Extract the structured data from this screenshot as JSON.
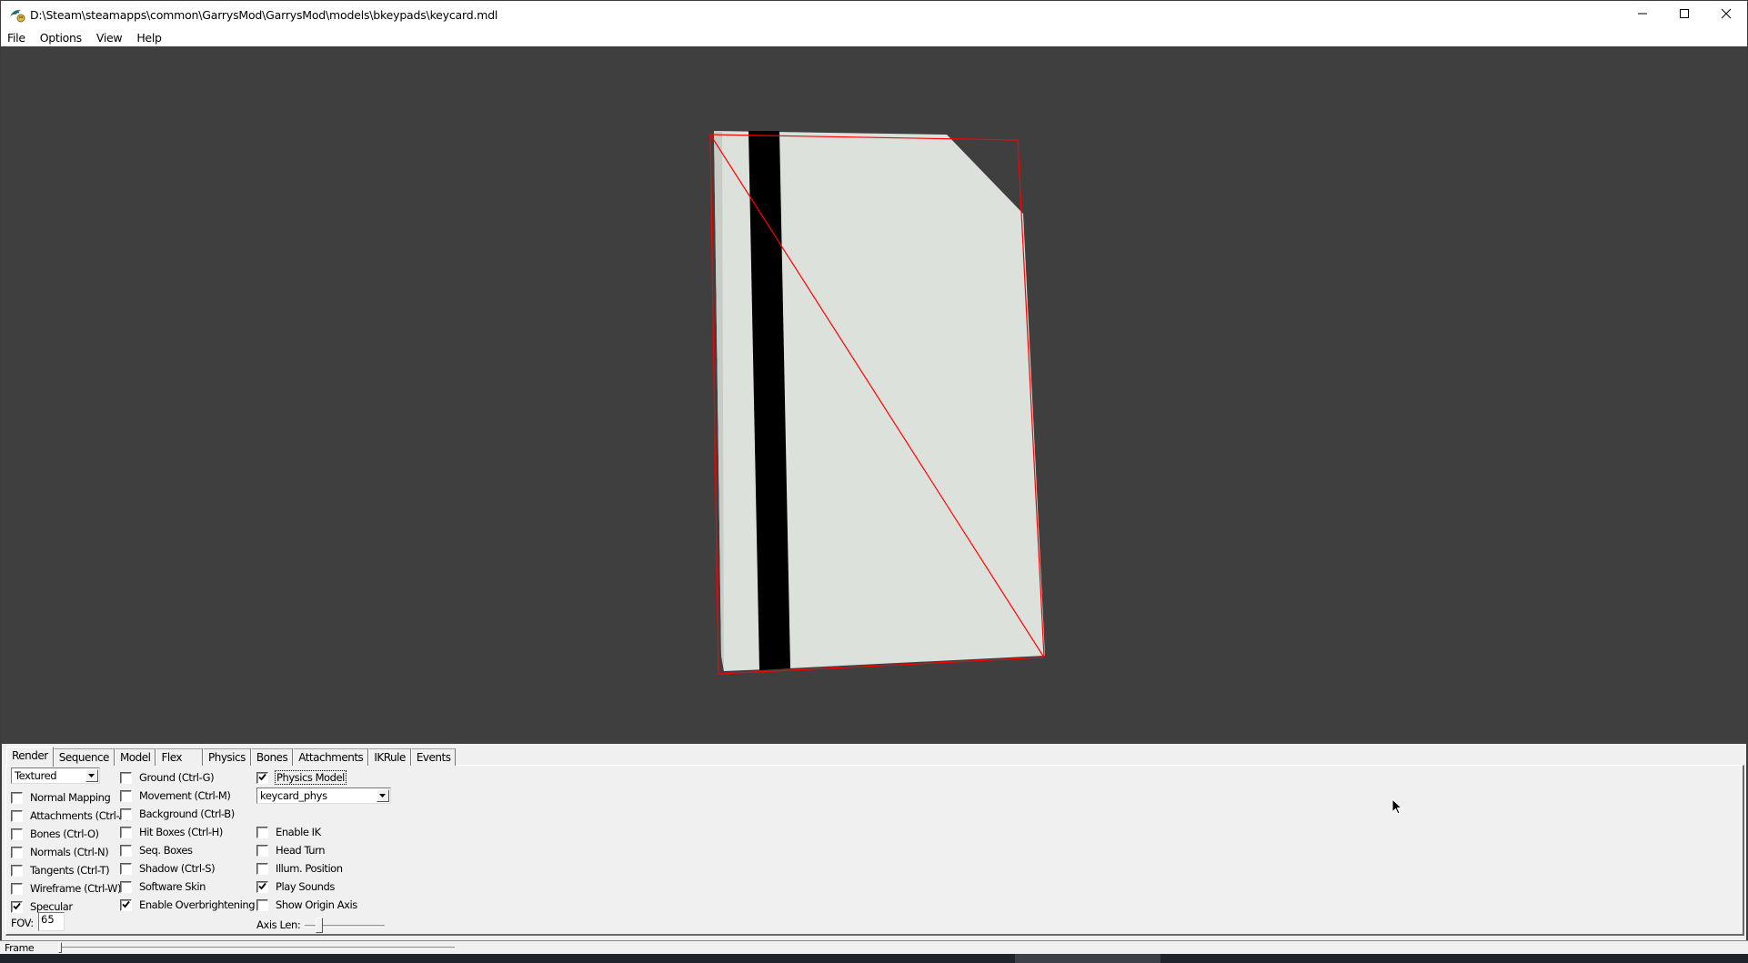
{
  "window": {
    "title": "D:\\Steam\\steamapps\\common\\GarrysMod\\GarrysMod\\models\\bkeypads\\keycard.mdl",
    "app_icon": "hlmv-icon",
    "controls": {
      "minimize": "minimize-icon",
      "maximize": "maximize-icon",
      "close": "close-icon"
    }
  },
  "menubar": {
    "items": [
      "File",
      "Options",
      "View",
      "Help"
    ]
  },
  "viewport": {
    "background": "#3f3f3f",
    "model_color": "#dde1dc",
    "stripe_color": "#000000",
    "physics_wire_color": "#ff0000"
  },
  "tabs": {
    "active": "Render",
    "items": [
      "Render",
      "Sequence",
      "Model",
      "Flex",
      "Physics",
      "Bones",
      "Attachments",
      "IKRule",
      "Events"
    ]
  },
  "render": {
    "render_mode": "Textured",
    "physics_model_combo": "keycard_phys",
    "column1": [
      {
        "label": "Normal Mapping",
        "checked": false
      },
      {
        "label": "Attachments (Ctrl-A)",
        "checked": false
      },
      {
        "label": "Bones (Ctrl-O)",
        "checked": false
      },
      {
        "label": "Normals (Ctrl-N)",
        "checked": false
      },
      {
        "label": "Tangents (Ctrl-T)",
        "checked": false
      },
      {
        "label": "Wireframe (Ctrl-W)",
        "checked": false
      },
      {
        "label": "Specular",
        "checked": true
      }
    ],
    "column2": [
      {
        "label": "Ground (Ctrl-G)",
        "checked": false
      },
      {
        "label": "Movement (Ctrl-M)",
        "checked": false
      },
      {
        "label": "Background (Ctrl-B)",
        "checked": false
      },
      {
        "label": "Hit Boxes (Ctrl-H)",
        "checked": false
      },
      {
        "label": "Seq. Boxes",
        "checked": false
      },
      {
        "label": "Shadow (Ctrl-S)",
        "checked": false
      },
      {
        "label": "Software Skin",
        "checked": false
      },
      {
        "label": "Enable Overbrightening",
        "checked": true
      }
    ],
    "column3": [
      {
        "label": "Physics Model",
        "checked": true
      },
      {
        "label": "Enable IK",
        "checked": false
      },
      {
        "label": "Head Turn",
        "checked": false
      },
      {
        "label": "Illum. Position",
        "checked": false
      },
      {
        "label": "Play Sounds",
        "checked": true
      },
      {
        "label": "Show Origin Axis",
        "checked": false
      }
    ],
    "fov_label": "FOV:",
    "fov_value": "65",
    "axis_len_label": "Axis Len:",
    "axis_len_fraction": 0.15
  },
  "frame": {
    "label": "Frame",
    "position_fraction": 0.0
  }
}
